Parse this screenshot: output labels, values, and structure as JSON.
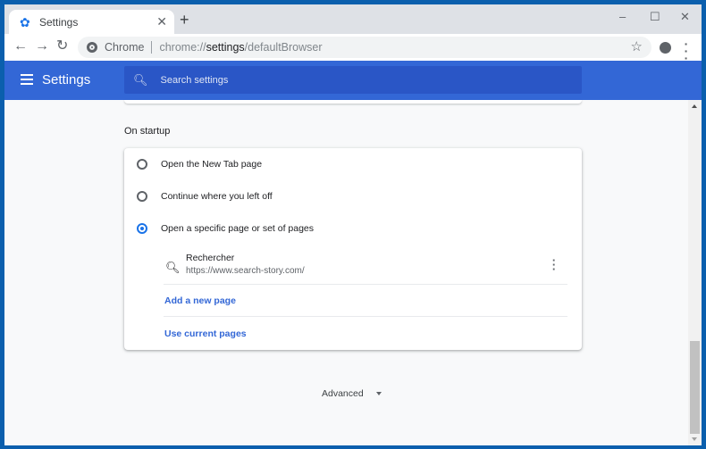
{
  "browser": {
    "tab": {
      "title": "Settings",
      "icon": "gear-icon",
      "close_glyph": "✕"
    },
    "new_tab_glyph": "+",
    "window_controls": {
      "minimize": "–",
      "maximize": "☐",
      "close": "✕"
    },
    "nav": {
      "back": "←",
      "forward": "→",
      "reload": "↻"
    },
    "omnibox": {
      "chip": "Chrome",
      "url_prefix": "chrome://",
      "url_host": "settings",
      "url_path": "/defaultBrowser"
    },
    "bookmark_star": "☆",
    "menu_glyph": "⋮"
  },
  "header": {
    "title": "Settings",
    "search_placeholder": "Search settings"
  },
  "startup": {
    "title": "On startup",
    "options": [
      {
        "label": "Open the New Tab page",
        "selected": false
      },
      {
        "label": "Continue where you left off",
        "selected": false
      },
      {
        "label": "Open a specific page or set of pages",
        "selected": true
      }
    ],
    "pages": [
      {
        "name": "Rechercher",
        "url": "https://www.search-story.com/"
      }
    ],
    "add_page_label": "Add a new page",
    "use_current_label": "Use current pages"
  },
  "advanced_label": "Advanced",
  "colors": {
    "accent": "#1a73e8",
    "header": "#3367d6",
    "link": "#3367d6"
  }
}
